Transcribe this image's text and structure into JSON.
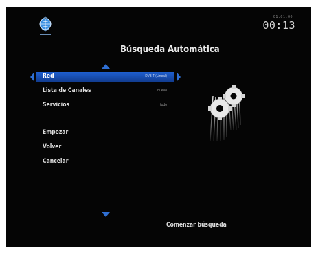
{
  "header": {
    "title": "Búsqueda Automática",
    "logo_icon": "globe-logo-icon",
    "clock_date": "01.01.00",
    "clock_time": "00:13"
  },
  "settings": [
    {
      "label": "Red",
      "value": "DVB-T (Lineal)"
    },
    {
      "label": "Lista de Canales",
      "value": "nuevo"
    },
    {
      "label": "Servicios",
      "value": "todo"
    }
  ],
  "actions": [
    {
      "label": "Empezar"
    },
    {
      "label": "Volver"
    },
    {
      "label": "Cancelar"
    }
  ],
  "footer": {
    "hint": "Comenzar búsqueda"
  },
  "colors": {
    "background": "#050505",
    "highlight": "#1e5fd0",
    "accent_arrow": "#2f6fd3",
    "text": "#dcdcdc"
  }
}
